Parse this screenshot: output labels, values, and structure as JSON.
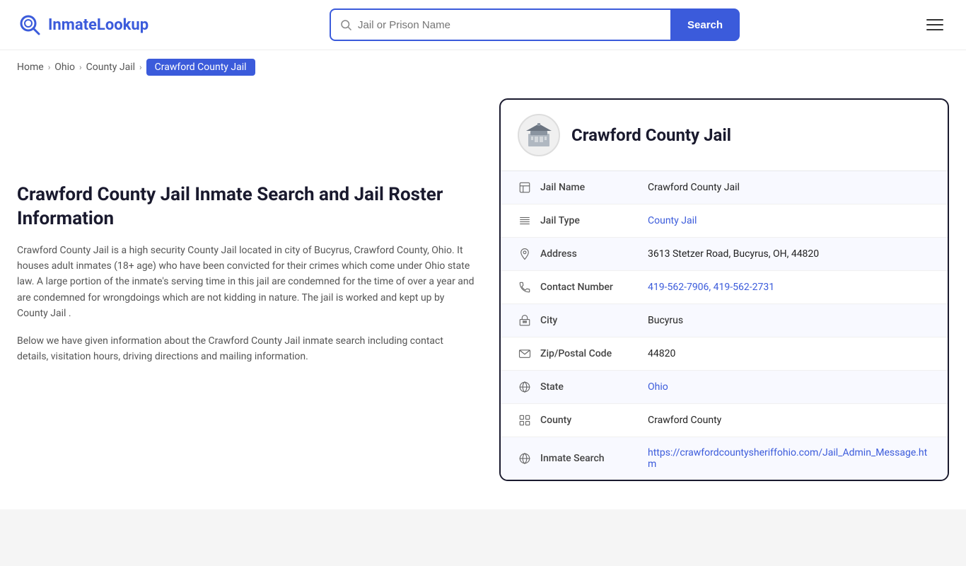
{
  "site": {
    "name_part1": "Inmate",
    "name_part2": "Lookup"
  },
  "header": {
    "search_placeholder": "Jail or Prison Name",
    "search_button_label": "Search"
  },
  "breadcrumb": {
    "items": [
      {
        "label": "Home",
        "href": "#"
      },
      {
        "label": "Ohio",
        "href": "#"
      },
      {
        "label": "County Jail",
        "href": "#"
      }
    ],
    "current": "Crawford County Jail"
  },
  "left": {
    "page_title": "Crawford County Jail Inmate Search and Jail Roster Information",
    "desc1": "Crawford County Jail is a high security County Jail located in city of Bucyrus, Crawford County, Ohio. It houses adult inmates (18+ age) who have been convicted for their crimes which come under Ohio state law. A large portion of the inmate's serving time in this jail are condemned for the time of over a year and are condemned for wrongdoings which are not kidding in nature. The jail is worked and kept up by County Jail .",
    "desc2": "Below we have given information about the Crawford County Jail inmate search including contact details, visitation hours, driving directions and mailing information."
  },
  "card": {
    "facility_name": "Crawford County Jail",
    "rows": [
      {
        "icon": "jail-icon",
        "label": "Jail Name",
        "value": "Crawford County Jail",
        "link": false
      },
      {
        "icon": "type-icon",
        "label": "Jail Type",
        "value": "County Jail",
        "link": true,
        "href": "#"
      },
      {
        "icon": "location-icon",
        "label": "Address",
        "value": "3613 Stetzer Road, Bucyrus, OH, 44820",
        "link": false
      },
      {
        "icon": "phone-icon",
        "label": "Contact Number",
        "value": "419-562-7906, 419-562-2731",
        "link": true,
        "href": "tel:4195627906"
      },
      {
        "icon": "city-icon",
        "label": "City",
        "value": "Bucyrus",
        "link": false
      },
      {
        "icon": "zip-icon",
        "label": "Zip/Postal Code",
        "value": "44820",
        "link": false
      },
      {
        "icon": "state-icon",
        "label": "State",
        "value": "Ohio",
        "link": true,
        "href": "#"
      },
      {
        "icon": "county-icon",
        "label": "County",
        "value": "Crawford County",
        "link": false
      },
      {
        "icon": "web-icon",
        "label": "Inmate Search",
        "value": "https://crawfordcountysheriffohio.com/Jail_Admin_Message.htm",
        "link": true,
        "href": "https://crawfordcountysheriffohio.com/Jail_Admin_Message.htm"
      }
    ]
  }
}
